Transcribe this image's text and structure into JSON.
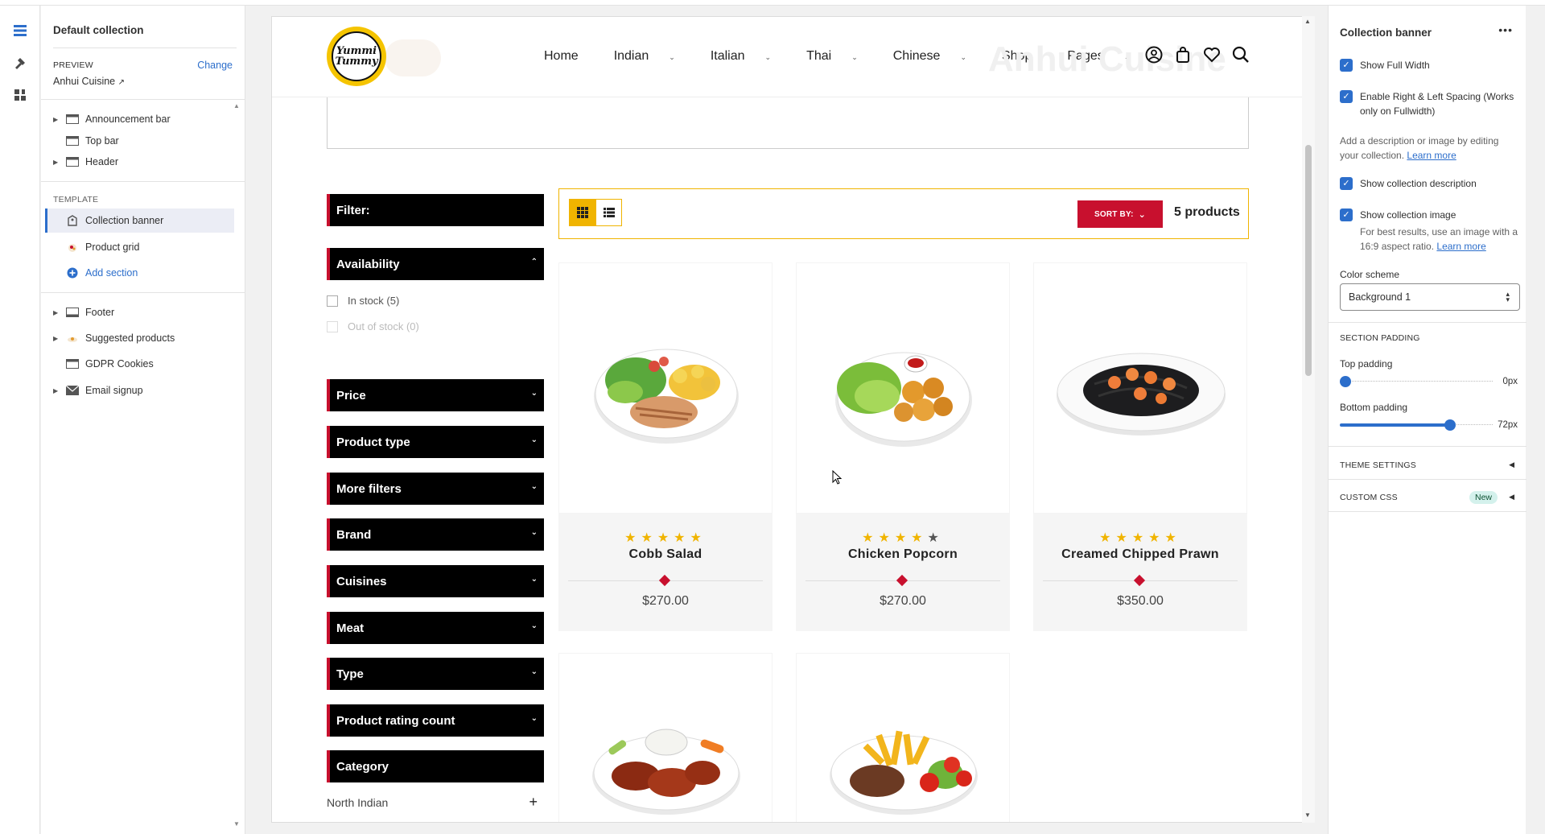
{
  "left_panel": {
    "title": "Default collection",
    "preview_label": "PREVIEW",
    "change_label": "Change",
    "preview_value": "Anhui Cuisine",
    "sections_top": [
      {
        "label": "Announcement bar",
        "icon": "layout-icon",
        "expandable": true
      },
      {
        "label": "Top bar",
        "icon": "layout-icon",
        "expandable": false
      },
      {
        "label": "Header",
        "icon": "layout-icon",
        "expandable": true
      }
    ],
    "template_label": "TEMPLATE",
    "template_items": [
      {
        "label": "Collection banner",
        "icon": "collection-icon",
        "selected": true
      },
      {
        "label": "Product grid",
        "icon": "product-icon",
        "selected": false
      }
    ],
    "add_section_label": "Add section",
    "sections_bottom": [
      {
        "label": "Footer",
        "icon": "layout-icon",
        "expandable": true
      },
      {
        "label": "Suggested products",
        "icon": "product-icon",
        "expandable": true
      },
      {
        "label": "GDPR Cookies",
        "icon": "layout-icon",
        "expandable": false
      },
      {
        "label": "Email signup",
        "icon": "email-icon",
        "expandable": true
      }
    ]
  },
  "store": {
    "logo_line1": "Yummi",
    "logo_line2": "Tummy",
    "nav": [
      {
        "label": "Home",
        "dropdown": false
      },
      {
        "label": "Indian",
        "dropdown": true
      },
      {
        "label": "Italian",
        "dropdown": true
      },
      {
        "label": "Thai",
        "dropdown": true
      },
      {
        "label": "Chinese",
        "dropdown": true
      },
      {
        "label": "Shop",
        "dropdown": false
      },
      {
        "label": "Pages",
        "dropdown": true
      }
    ],
    "ghost_title": "Anhui Cuisine",
    "filter_label": "Filter:",
    "availability_label": "Availability",
    "availability_options": [
      {
        "label": "In stock (5)",
        "disabled": false
      },
      {
        "label": "Out of stock (0)",
        "disabled": true
      }
    ],
    "filters": [
      "Price",
      "Product type",
      "More filters",
      "Brand",
      "Cuisines",
      "Meat",
      "Type",
      "Product rating count"
    ],
    "category_label": "Category",
    "category_item": "North Indian",
    "sort_label": "SORT BY:",
    "product_count": "5 products",
    "products": [
      {
        "name": "Cobb Salad",
        "price": "$270.00",
        "rating": 5
      },
      {
        "name": "Chicken Popcorn",
        "price": "$270.00",
        "rating": 4
      },
      {
        "name": "Creamed Chipped Prawn",
        "price": "$350.00",
        "rating": 5
      }
    ]
  },
  "right_panel": {
    "title": "Collection banner",
    "show_full_width": "Show Full Width",
    "enable_spacing": "Enable Right & Left Spacing (Works only on Fullwidth)",
    "desc_note": "Add a description or image by editing your collection.",
    "learn_more": "Learn more",
    "show_description": "Show collection description",
    "show_image": "Show collection image",
    "image_note": "For best results, use an image with a 16:9 aspect ratio.",
    "color_scheme_label": "Color scheme",
    "color_scheme_value": "Background 1",
    "section_padding": "SECTION PADDING",
    "top_padding_label": "Top padding",
    "top_padding_value": "0px",
    "top_padding_fraction": 0,
    "bottom_padding_label": "Bottom padding",
    "bottom_padding_value": "72px",
    "bottom_padding_fraction": 0.72,
    "theme_settings": "THEME SETTINGS",
    "custom_css": "CUSTOM CSS",
    "new_badge": "New"
  },
  "colors": {
    "accent_blue": "#2c6ecb",
    "brand_red": "#c8102e",
    "brand_yellow": "#f0b400"
  }
}
